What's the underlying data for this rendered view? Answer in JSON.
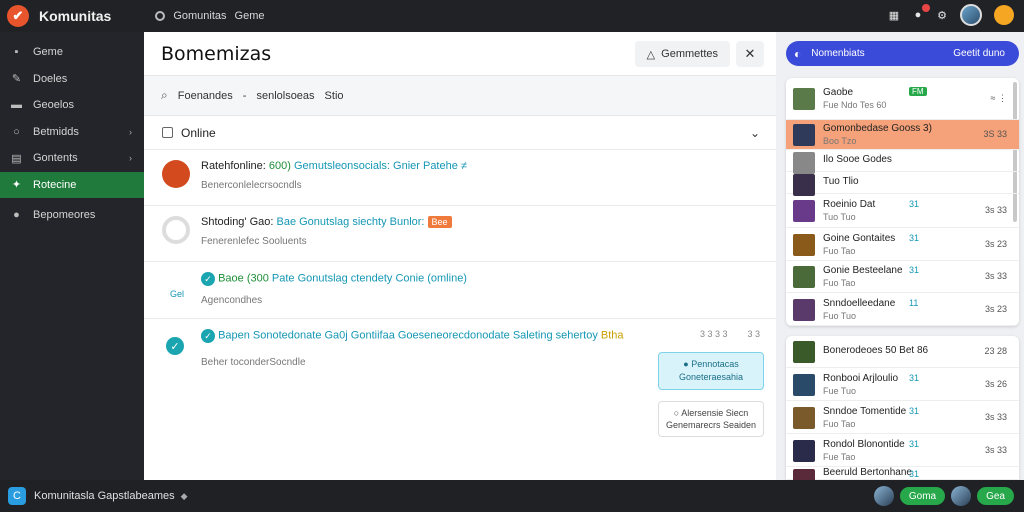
{
  "app": {
    "title": "Komunitas",
    "logo_glyph": "✔"
  },
  "topnav": {
    "item1": "Gomunitas",
    "item2": "Geme"
  },
  "sidebar": {
    "items": [
      {
        "label": "Geme",
        "icon": "grid-icon"
      },
      {
        "label": "Doeles",
        "icon": "pen-icon"
      },
      {
        "label": "Geoelos",
        "icon": "folder-icon"
      },
      {
        "label": "Betmidds",
        "icon": "circle-icon",
        "chevron": "›"
      },
      {
        "label": "Gontents",
        "icon": "list-icon",
        "chevron": "›"
      },
      {
        "label": "Rotecine",
        "icon": "wrench-icon",
        "active": true
      },
      {
        "label": "Bepomeores",
        "icon": "user-icon"
      }
    ]
  },
  "main": {
    "title": "Bomemizas",
    "head_button": "Gemmettes",
    "search": {
      "a": "Foenandes",
      "dash": "-",
      "b": "senlolsoeas",
      "c": "Stio"
    },
    "online_label": "Online",
    "messages": [
      {
        "name": "Ratehfonline:",
        "tag_green": "600)",
        "rest": "Gemutsleonsocials: Gnier Patehe ≠",
        "sub": "Benerconlelecrsocndls"
      },
      {
        "name": "Shtoding' Gao:",
        "rest": "Bae Gonutslag siechty Bunlor:",
        "tag": "Bee",
        "sub": "Fenerenlefec Sooluents"
      },
      {
        "name": "Baoe",
        "tag_green": "(300",
        "rest": "Pate Gonutslag ctendety Conie (omline)",
        "sub": "Agencondhes",
        "side": "Gel"
      },
      {
        "name": "Bapen Sonotedonate Ga0j Gontiifaa Goeseneorecdonodate Saleting sehertoy",
        "tag": "Btha",
        "sub": "Beher toconderSocndle",
        "meta1": "3 3 3 3",
        "meta2": "3 3"
      }
    ],
    "tip1": {
      "line1": "Pennotacas",
      "line2": "Goneteraesahia"
    },
    "tip2": {
      "line1": "Alersensie Siecn",
      "line2": "Genemarecrs Seaiden"
    }
  },
  "right": {
    "header": {
      "label": "Nomenbiats",
      "right": "Geetit duno"
    },
    "card1": [
      {
        "name": "Gaobe",
        "badge": "FM",
        "sub": "Fue Ndo Tes 60",
        "right": "≈ ⋮",
        "color": "#5a7a4a"
      },
      {
        "name": "Gomonbedase Gooss 3)",
        "sub": "Boo Tzo",
        "right": "3S 33",
        "color": "#2f3a5a",
        "hl": true
      },
      {
        "name": "Ilo Sooe Godes",
        "sub": "",
        "right": "",
        "color": "#888"
      },
      {
        "name": "Tuo Tlio",
        "sub": "",
        "right": "",
        "color": "#3a2f4a"
      },
      {
        "name": "Roeinio Dat",
        "num": "31",
        "sub": "Tuo Tuo",
        "right": "3s 33",
        "color": "#6a3a8a"
      },
      {
        "name": "Goine Gontaites",
        "num": "31",
        "sub": "Fuo Tao",
        "right": "3s 23",
        "color": "#8a5a1a"
      },
      {
        "name": "Gonie Besteelane",
        "num": "31",
        "sub": "Fuo Tao",
        "right": "3s 33",
        "color": "#4a6a3a"
      },
      {
        "name": "Snndoelleedane",
        "num": "11",
        "sub": "Fuo Tuo",
        "right": "3s 23",
        "color": "#5a3a6a"
      }
    ],
    "card2": [
      {
        "name": "Bonerodeoes 50 Bet 86",
        "sub": "",
        "right": "23 28",
        "color": "#3a5a2a"
      },
      {
        "name": "Ronbooi Arjloulio",
        "num": "31",
        "sub": "Fue Tuo",
        "right": "3s 26",
        "color": "#2a4a6a"
      },
      {
        "name": "Snndoe Tomentide",
        "num": "31",
        "sub": "Fuo Tao",
        "right": "3s 33",
        "color": "#7a5a2a"
      },
      {
        "name": "Rondol Blonontide",
        "num": "31",
        "sub": "Fue Tao",
        "right": "3s 33",
        "color": "#2a2a4a"
      },
      {
        "name": "Beeruld Bertonhane",
        "num": "31",
        "sub": "",
        "right": "",
        "color": "#5a2a3a"
      }
    ]
  },
  "bottombar": {
    "text": "Komunitasla Gapstlabeames",
    "text2": "◆",
    "pill1": "Goma",
    "pill2": "Gea"
  }
}
